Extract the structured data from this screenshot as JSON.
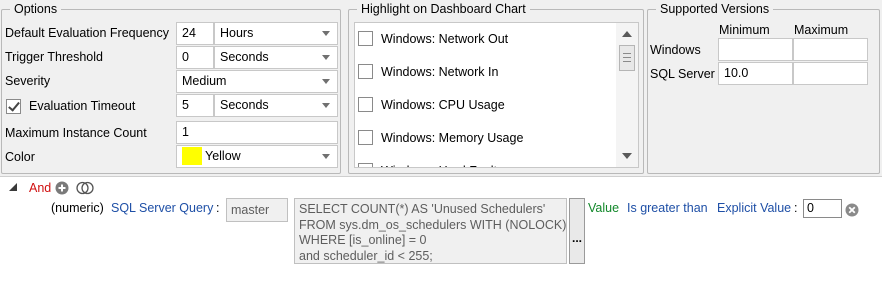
{
  "options": {
    "title": "Options",
    "frequency": {
      "label": "Default Evaluation Frequency",
      "value": "24",
      "unit": "Hours"
    },
    "threshold": {
      "label": "Trigger Threshold",
      "value": "0",
      "unit": "Seconds"
    },
    "severity": {
      "label": "Severity",
      "value": "Medium"
    },
    "timeout": {
      "label": "Evaluation Timeout",
      "checked": true,
      "value": "5",
      "unit": "Seconds"
    },
    "max_instance": {
      "label": "Maximum Instance Count",
      "value": "1"
    },
    "color": {
      "label": "Color",
      "value": "Yellow",
      "swatch": "#ffff00"
    }
  },
  "highlight": {
    "title": "Highlight on Dashboard Chart",
    "items": [
      {
        "label": "Windows: Network Out",
        "checked": false
      },
      {
        "label": "Windows: Network In",
        "checked": false
      },
      {
        "label": "Windows: CPU Usage",
        "checked": false
      },
      {
        "label": "Windows: Memory Usage",
        "checked": false
      },
      {
        "label": "Windows: Hard Faults",
        "checked": false
      }
    ]
  },
  "supported": {
    "title": "Supported Versions",
    "col_min": "Minimum",
    "col_max": "Maximum",
    "rows": [
      {
        "label": "Windows",
        "min": "",
        "max": ""
      },
      {
        "label": "SQL Server",
        "min": "10.0",
        "max": ""
      }
    ]
  },
  "rule": {
    "operator": "And",
    "type": "(numeric)",
    "source": "SQL Server Query",
    "colon": ":",
    "database": "master",
    "query": "SELECT COUNT(*) AS 'Unused Schedulers'\nFROM sys.dm_os_schedulers WITH (NOLOCK)\nWHERE [is_online] = 0\nand scheduler_id < 255;",
    "ellipsis": "...",
    "value_label": "Value",
    "comparison": "Is greater than",
    "compare_type": "Explicit Value",
    "compare_colon": ":",
    "compare_value": "0"
  },
  "colors": {
    "link": "#1e4fa6",
    "value_green": "#12882a",
    "operator_red": "#d01010"
  }
}
